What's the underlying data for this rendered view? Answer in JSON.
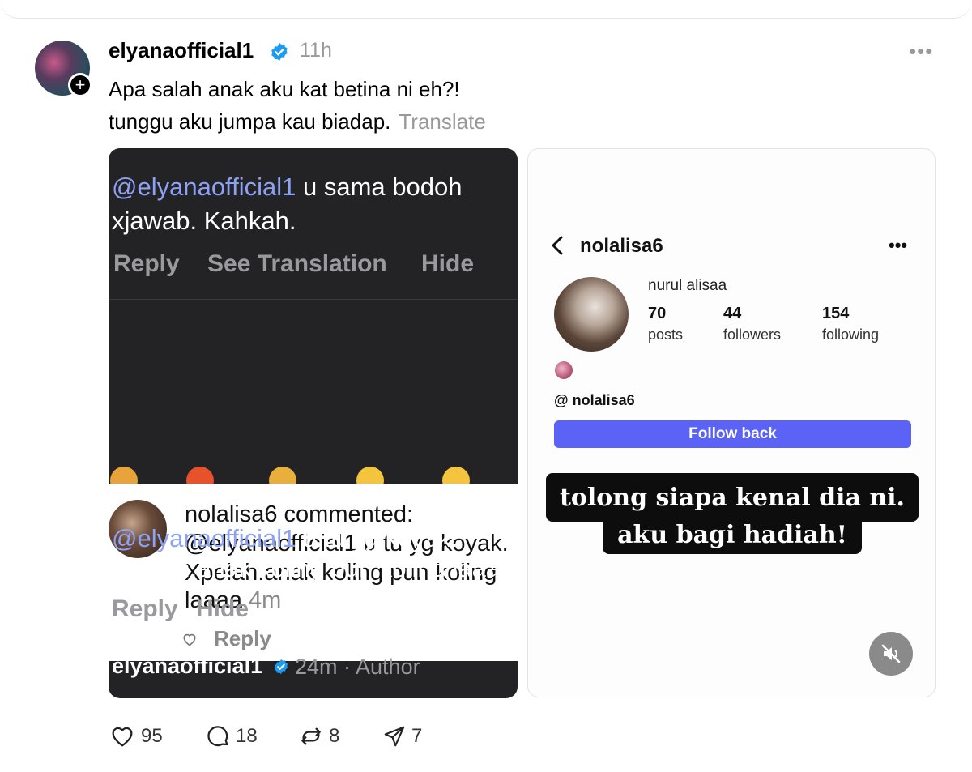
{
  "post": {
    "username": "elyanaofficial1",
    "time": "11h",
    "more": "•••",
    "text_line1": "Apa salah anak aku kat betina ni eh?!",
    "text_line2": "tunggu aku jumpa kau biadap.",
    "translate": "Translate"
  },
  "left_image": {
    "line1_mention": "@elyanaofficial1",
    "line1_rest": " u sama bodoh",
    "line2": "xjawab. Kahkah.",
    "actions": [
      "Reply",
      "See Translation",
      "Hide"
    ],
    "popup": {
      "header_user": "nolalisa6",
      "header_rest": " commented:",
      "line1": "@elyanaofficial1 u tu yg koyak.",
      "line2": "Xpelah.anak koling pun koling",
      "line3": "laaaa",
      "time": "4m",
      "reply": "Reply"
    },
    "lower_mention": "@elyanaofficial1",
    "lower_rest": " u tu yg koyak.",
    "lower_line2": "Xpelah.anak koling pun koling laaaa",
    "lower_actions": [
      "Reply",
      "Hide"
    ],
    "footer_user": "elyanaofficial1",
    "footer_meta": "24m · Author"
  },
  "right_image": {
    "username": "nolalisa6",
    "more": "•••",
    "name": "nurul alisaa",
    "stats": [
      {
        "value": "70",
        "label": "posts"
      },
      {
        "value": "44",
        "label": "followers"
      },
      {
        "value": "154",
        "label": "following"
      }
    ],
    "threads_handle": "nolalisa6",
    "follow_button": "Follow back",
    "caption_line1": "tolong siapa kenal dia ni.",
    "caption_line2": "aku bagi hadiah!"
  },
  "actions": {
    "likes": "95",
    "comments": "18",
    "reposts": "8",
    "shares": "7"
  },
  "colors": {
    "mention": "#8ea2f5",
    "verified": "#1d9bf0",
    "follow_button": "#5a63f5"
  }
}
